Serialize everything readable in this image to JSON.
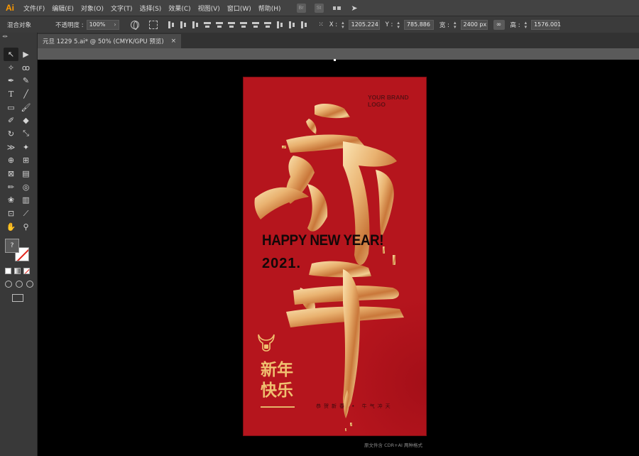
{
  "app": {
    "logo": "Ai"
  },
  "menu": [
    "文件(F)",
    "编辑(E)",
    "对象(O)",
    "文字(T)",
    "选择(S)",
    "效果(C)",
    "视图(V)",
    "窗口(W)",
    "帮助(H)"
  ],
  "menu_icons": {
    "bridge": "Br",
    "stock": "St",
    "workspace": "grid-icon",
    "publish": "send-icon"
  },
  "control_bar": {
    "selection_label": "混合对象",
    "opacity_label": "不透明度 :",
    "opacity_value": "100%",
    "x_label": "X :",
    "x_value": "1205.224",
    "y_label": "Y :",
    "y_value": "785.886",
    "w_label": "宽 :",
    "w_value": "2400 px",
    "h_label": "高 :",
    "h_value": "1576.001"
  },
  "document_tab": {
    "title": "元旦 1229 5.ai* @ 50% (CMYK/GPU 预览)",
    "close": "×"
  },
  "toolbox": {
    "tools": [
      "selection-tool",
      "direct-selection-tool",
      "magic-wand-tool",
      "lasso-tool",
      "pen-tool",
      "curvature-tool",
      "type-tool",
      "line-tool",
      "rectangle-tool",
      "paintbrush-tool",
      "shaper-tool",
      "eraser-tool",
      "rotate-tool",
      "scale-tool",
      "width-tool",
      "puppet-warp-tool",
      "shape-builder-tool",
      "perspective-grid-tool",
      "mesh-tool",
      "gradient-tool",
      "eyedropper-tool",
      "blend-tool",
      "symbol-sprayer-tool",
      "column-graph-tool",
      "artboard-tool",
      "slice-tool",
      "hand-tool",
      "zoom-tool"
    ],
    "fill_label": "?"
  },
  "artwork": {
    "brand_line1": "YOUR BRAND",
    "brand_line2": "LOGO",
    "headline": "HAPPY NEW YEAR!",
    "year": "2021.",
    "chinese_greeting": "新年快乐",
    "tagline": "恭贺新春 • 牛气冲天",
    "colors": {
      "background": "#b5151d",
      "gold": "#e6b56a",
      "dark": "#120808"
    }
  },
  "footer_note": "原文件含 CDR+AI 两种格式"
}
